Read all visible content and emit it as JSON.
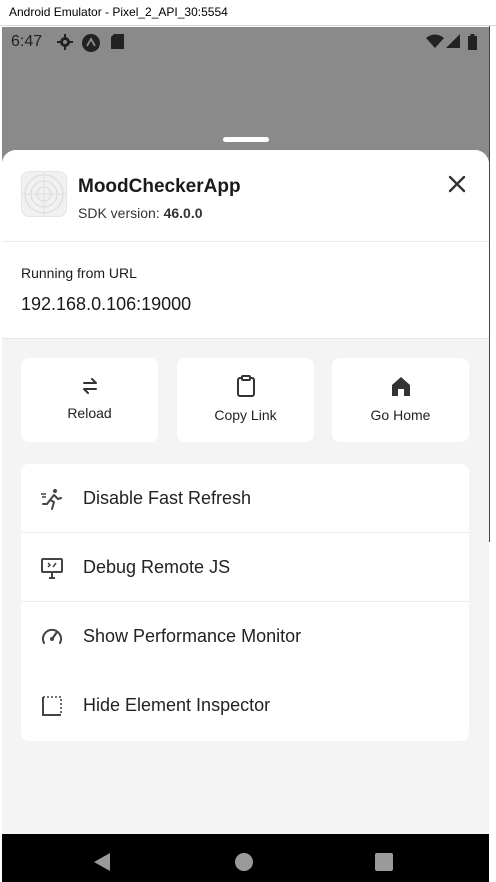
{
  "window": {
    "title": "Android Emulator - Pixel_2_API_30:5554"
  },
  "statusbar": {
    "time": "6:47"
  },
  "header": {
    "app_name": "MoodCheckerApp",
    "sdk_label": "SDK version: ",
    "sdk_version": "46.0.0"
  },
  "url_section": {
    "label": "Running from URL",
    "value": "192.168.0.106:19000"
  },
  "quick_actions": [
    {
      "label": "Reload",
      "icon": "reload-icon"
    },
    {
      "label": "Copy Link",
      "icon": "clipboard-icon"
    },
    {
      "label": "Go Home",
      "icon": "home-icon"
    }
  ],
  "menu": [
    {
      "label": "Disable Fast Refresh",
      "icon": "running-person-icon"
    },
    {
      "label": "Debug Remote JS",
      "icon": "monitor-debug-icon"
    },
    {
      "label": "Show Performance Monitor",
      "icon": "speedometer-icon"
    },
    {
      "label": "Hide Element Inspector",
      "icon": "dotted-square-icon"
    }
  ],
  "navbar": {
    "back_icon": "back-triangle-icon",
    "home_icon": "home-circle-icon",
    "recents_icon": "recents-square-icon"
  }
}
